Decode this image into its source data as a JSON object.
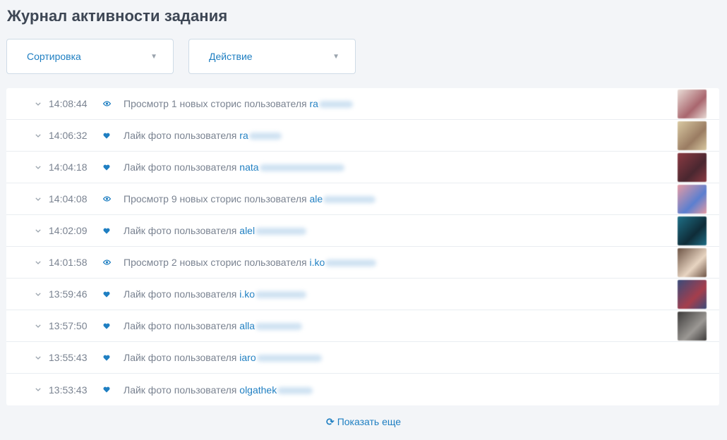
{
  "page": {
    "title": "Журнал активности задания"
  },
  "filters": {
    "sort_label": "Сортировка",
    "action_label": "Действие"
  },
  "rows": [
    {
      "time": "14:08:44",
      "icon": "eye-icon",
      "text": "Просмотр 1 новых сторис пользователя ",
      "user": "ra",
      "has_thumb": true
    },
    {
      "time": "14:06:32",
      "icon": "heart-icon",
      "text": "Лайк фото пользователя ",
      "user": "ra",
      "has_thumb": true
    },
    {
      "time": "14:04:18",
      "icon": "heart-icon",
      "text": "Лайк фото пользователя ",
      "user": "nata",
      "has_thumb": true
    },
    {
      "time": "14:04:08",
      "icon": "eye-icon",
      "text": "Просмотр 9 новых сторис пользователя ",
      "user": "ale",
      "has_thumb": true
    },
    {
      "time": "14:02:09",
      "icon": "heart-icon",
      "text": "Лайк фото пользователя ",
      "user": "alel",
      "has_thumb": true
    },
    {
      "time": "14:01:58",
      "icon": "eye-icon",
      "text": "Просмотр 2 новых сторис пользователя ",
      "user": "i.ko",
      "has_thumb": true
    },
    {
      "time": "13:59:46",
      "icon": "heart-icon",
      "text": "Лайк фото пользователя ",
      "user": "i.ko",
      "has_thumb": true
    },
    {
      "time": "13:57:50",
      "icon": "heart-icon",
      "text": "Лайк фото пользователя ",
      "user": "alla",
      "has_thumb": true
    },
    {
      "time": "13:55:43",
      "icon": "heart-icon",
      "text": "Лайк фото пользователя ",
      "user": "iaro",
      "has_thumb": false
    },
    {
      "time": "13:53:43",
      "icon": "heart-icon",
      "text": "Лайк фото пользователя ",
      "user": "olgathek",
      "has_thumb": false
    }
  ],
  "footer": {
    "show_more_label": "Показать еще"
  },
  "colors": {
    "accent": "#1f7fc2",
    "text": "#7a8391",
    "title": "#3d4654",
    "background": "#f3f5f8"
  }
}
